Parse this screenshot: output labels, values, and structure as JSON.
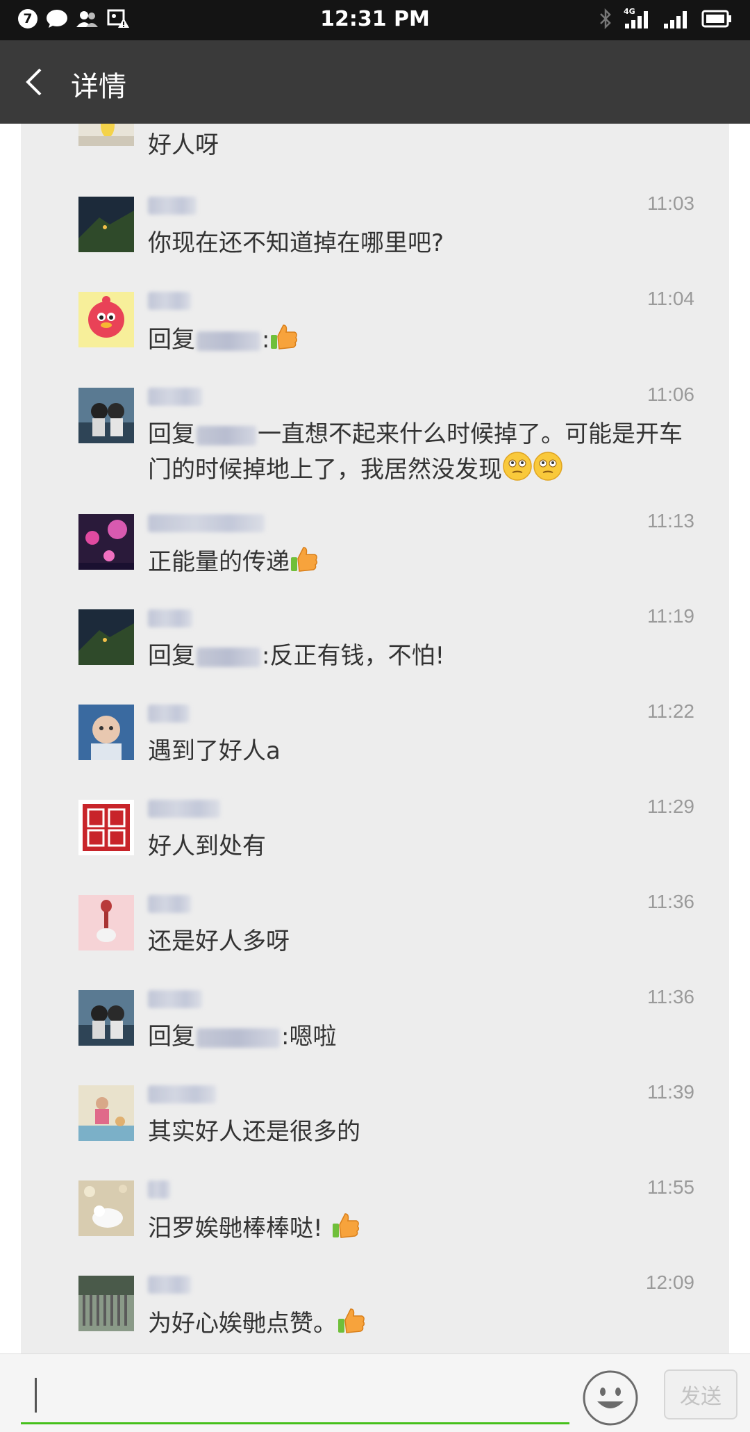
{
  "status_bar": {
    "notification_count": "7",
    "time": "12:31 PM",
    "network": "4G"
  },
  "nav": {
    "title": "详情"
  },
  "comments": [
    {
      "time": "",
      "text": "好人呀"
    },
    {
      "time": "11:03",
      "text": "你现在还不知道掉在哪里吧?"
    },
    {
      "time": "11:04",
      "prefix": "回复",
      "suffix": ":"
    },
    {
      "time": "11:06",
      "prefix": "回复",
      "suffix": "一直想不起来什么时候掉了。可能是开车门的时候掉地上了，我居然没发现"
    },
    {
      "time": "11:13",
      "text": "正能量的传递"
    },
    {
      "time": "11:19",
      "prefix": "回复",
      "suffix": ":反正有钱，不怕!"
    },
    {
      "time": "11:22",
      "text": "遇到了好人a"
    },
    {
      "time": "11:29",
      "text": "好人到处有"
    },
    {
      "time": "11:36",
      "text": "还是好人多呀"
    },
    {
      "time": "11:36",
      "prefix": "回复",
      "suffix": ":嗯啦"
    },
    {
      "time": "11:39",
      "text": "其实好人还是很多的"
    },
    {
      "time": "11:55",
      "text": "汨罗娭毑棒棒哒!"
    },
    {
      "time": "12:09",
      "text": "为好心娭毑点赞。"
    }
  ],
  "input": {
    "value": "",
    "send_label": "发送"
  },
  "colors": {
    "status_bar": "#141414",
    "nav_bar": "#3a3a3a",
    "panel": "#ededed",
    "input_underline": "#45c01a",
    "timestamp": "#9a9a9a"
  }
}
